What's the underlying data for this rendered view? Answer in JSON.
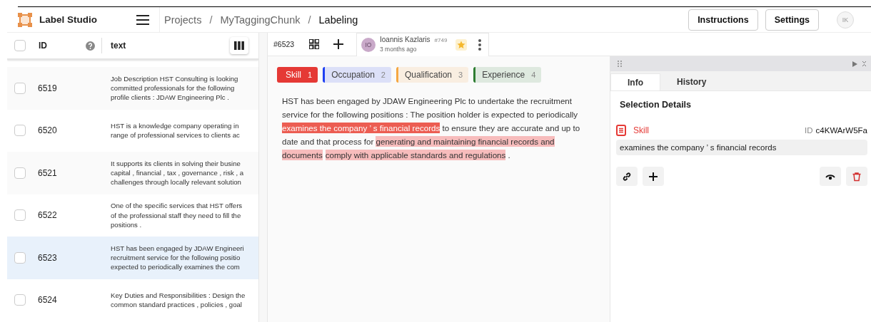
{
  "app": {
    "name": "Label Studio"
  },
  "breadcrumbs": [
    {
      "kind": "link",
      "label": "Projects",
      "current": false
    },
    {
      "kind": "separator",
      "label": "/"
    },
    {
      "kind": "link",
      "label": "MyTaggingChunk",
      "current": false
    },
    {
      "kind": "separator",
      "label": "/"
    },
    {
      "kind": "link",
      "label": "Labeling",
      "current": true
    }
  ],
  "header_buttons": [
    "Instructions",
    "Settings"
  ],
  "user_avatar": "IK",
  "table": {
    "columns": [
      "ID",
      "text"
    ],
    "select_all_checked": false,
    "rows": [
      {
        "id": "6519",
        "lines": [
          "Job Description HST Consulting is looking",
          "committed professionals for the following",
          "profile clients : JDAW Engineering Plc ."
        ],
        "selected": false,
        "checked": false
      },
      {
        "id": "6520",
        "lines": [
          "HST is a knowledge company operating in",
          "range of professional services to clients ac"
        ],
        "selected": false,
        "checked": false
      },
      {
        "id": "6521",
        "lines": [
          "It supports its clients in solving their busine",
          "capital , financial , tax , governance , risk , a",
          "challenges through locally relevant solution"
        ],
        "selected": false,
        "checked": false
      },
      {
        "id": "6522",
        "lines": [
          "One of the specific services that HST offers",
          "of the professional staff they need to fill the",
          "positions ."
        ],
        "selected": false,
        "checked": false
      },
      {
        "id": "6523",
        "lines": [
          "HST has been engaged by JDAW Engineeri",
          "recruitment service for the following positio",
          "expected to periodically examines the com"
        ],
        "selected": true,
        "checked": false
      },
      {
        "id": "6524",
        "lines": [
          "Key Duties and Responsibilities : Design the",
          "common standard practices , policies , goal"
        ],
        "selected": false,
        "checked": false
      }
    ]
  },
  "task": {
    "id": "#6523",
    "annotator": {
      "initials": "IO",
      "name": "Ioannis Kazlaris",
      "number": "#749",
      "time": "3 months ago",
      "starred": true
    }
  },
  "labels": [
    {
      "name": "Skill",
      "hotkey": "1",
      "color": "#e53935",
      "selected": true
    },
    {
      "name": "Occupation",
      "hotkey": "2",
      "color": "#1e3ff2",
      "selected": false
    },
    {
      "name": "Qualification",
      "hotkey": "3",
      "color": "#f5a742",
      "selected": false
    },
    {
      "name": "Experience",
      "hotkey": "4",
      "color": "#2e7d32",
      "selected": false
    }
  ],
  "document_lines": [
    [
      {
        "kind": "plain",
        "text": "HST has been engaged by JDAW Engineering Plc to undertake the recruitment"
      }
    ],
    [
      {
        "kind": "plain",
        "text": "service for the following positions : The position holder is expected to periodically"
      }
    ],
    [
      {
        "kind": "region",
        "text": "examines the company ’ s financial records",
        "selected": true
      },
      {
        "kind": "plain",
        "text": " to ensure they are accurate and up to"
      }
    ],
    [
      {
        "kind": "plain",
        "text": "date and that process for "
      },
      {
        "kind": "region",
        "text": "generating and maintaining financial records and",
        "selected": false
      }
    ],
    [
      {
        "kind": "region",
        "text": "documents",
        "selected": false
      },
      {
        "kind": "region",
        "text": "comply with applicable standards and regulations",
        "selected": false
      },
      {
        "kind": "plain",
        "text": " ."
      }
    ]
  ],
  "side_tabs": [
    {
      "label": "Info",
      "selected": true
    },
    {
      "label": "History",
      "selected": false
    }
  ],
  "selection": {
    "heading": "Selection Details",
    "label": "Skill",
    "id_label": "ID",
    "id": "c4KWArW5Fa",
    "text": "examines the company ’ s financial records"
  }
}
